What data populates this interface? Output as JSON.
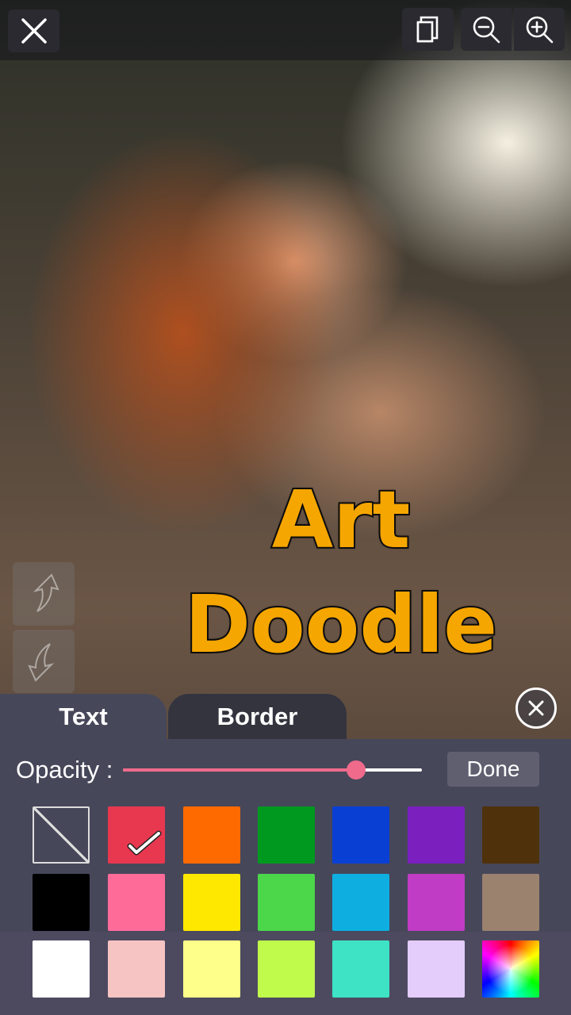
{
  "artwork": {
    "line1": "Art",
    "line2": "Doodle",
    "text_color": "#f6a600",
    "stroke_color": "#111111"
  },
  "toolbar": {
    "close_icon": "close-icon",
    "copy_icon": "copy-icon",
    "zoom_out_icon": "zoom-out-icon",
    "zoom_in_icon": "zoom-in-icon"
  },
  "side": {
    "redo_icon": "redo-arrow-icon",
    "undo_icon": "undo-arrow-icon"
  },
  "tabs": [
    {
      "label": "Text",
      "active": true
    },
    {
      "label": "Border",
      "active": false
    }
  ],
  "opacity": {
    "label": "Opacity :",
    "value": 0.78
  },
  "done_label": "Done",
  "accent": "#f06a8c",
  "palette": {
    "selected_index": 1,
    "rows": [
      [
        "none",
        "#e8384f",
        "#ff6a00",
        "#00991f",
        "#0a3fd4",
        "#7b1fbe",
        "#4f320c"
      ],
      [
        "#000000",
        "#ff6b99",
        "#ffe800",
        "#4cd64a",
        "#0eafe0",
        "#c03cc4",
        "#9b826f"
      ],
      [
        "#ffffff",
        "#f6c4c2",
        "#fefe8a",
        "#c0fb4c",
        "#3ee3c6",
        "#e4ccfb",
        "rainbow"
      ]
    ]
  }
}
